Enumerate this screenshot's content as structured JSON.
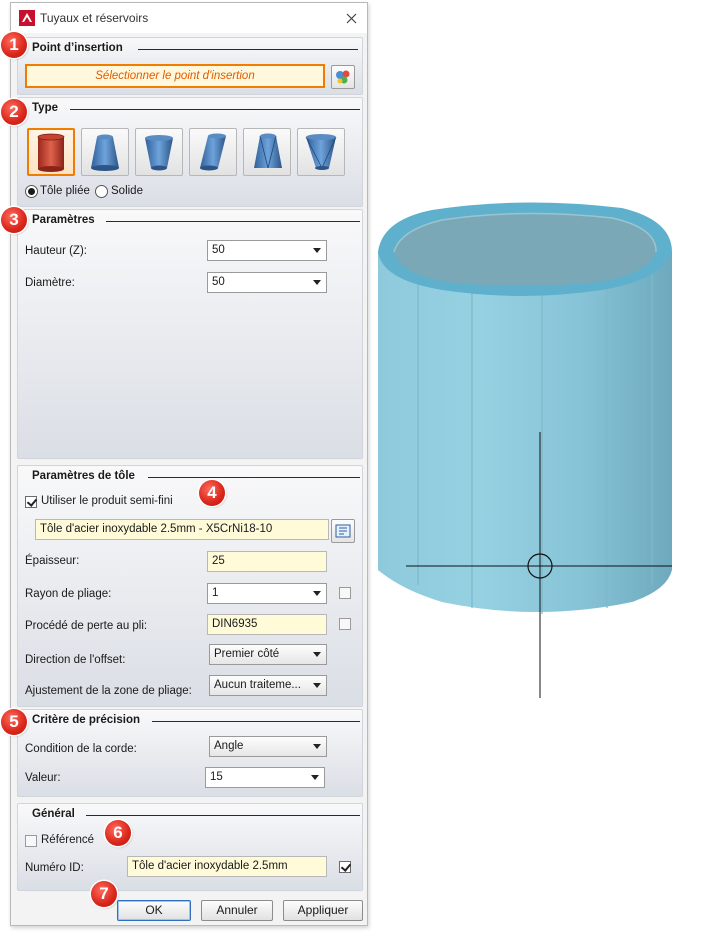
{
  "window": {
    "title": "Tuyaux et réservoirs",
    "app_icon": "app-logo-icon",
    "close_icon": "close-icon"
  },
  "badges": [
    "1",
    "2",
    "3",
    "4",
    "5",
    "6",
    "7"
  ],
  "insertion": {
    "title": "Point d’insertion",
    "button_label": "Sélectionner le point d'insertion"
  },
  "type": {
    "title": "Type",
    "shapes": [
      "cylinder-red-icon",
      "cone-frustum-icon",
      "tapered-cylinder-icon",
      "oblique-cylinder-icon",
      "twisted-frustum-icon",
      "transition-piece-icon"
    ],
    "selected_index": 0,
    "radio_tole": "Tôle pliée",
    "radio_solide": "Solide",
    "selected_radio": "tole"
  },
  "params": {
    "title": "Paramètres",
    "hauteur_label": "Hauteur (Z):",
    "hauteur_value": "50",
    "diametre_label": "Diamètre:",
    "diametre_value": "50"
  },
  "sheet": {
    "title": "Paramètres de tôle",
    "use_semi_label": "Utiliser le produit semi-fini",
    "use_semi_checked": true,
    "material": "Tôle d'acier inoxydable 2.5mm - X5CrNi18-10",
    "epaisseur_label": "Épaisseur:",
    "epaisseur_value": "25",
    "rayon_label": "Rayon de pliage:",
    "rayon_value": "1",
    "procede_label": "Procédé de perte au pli:",
    "procede_value": "DIN6935",
    "direction_label": "Direction de l'offset:",
    "direction_value": "Premier côté",
    "ajustement_label": "Ajustement de la zone de pliage:",
    "ajustement_value": "Aucun traiteme..."
  },
  "precision": {
    "title": "Critère de précision",
    "condition_label": "Condition de la corde:",
    "condition_value": "Angle",
    "valeur_label": "Valeur:",
    "valeur_value": "15"
  },
  "general": {
    "title": "Général",
    "reference_label": "Référencé",
    "reference_checked": false,
    "id_label": "Numéro ID:",
    "id_value": "Tôle d'acier inoxydable 2.5mm",
    "id_checked": true
  },
  "buttons": {
    "ok": "OK",
    "annuler": "Annuler",
    "appliquer": "Appliquer"
  },
  "colors": {
    "accent": "#f07c00",
    "badge": "#d9251a",
    "field_yellow": "#fffbd9",
    "model_blue": "#8fc9dc"
  }
}
